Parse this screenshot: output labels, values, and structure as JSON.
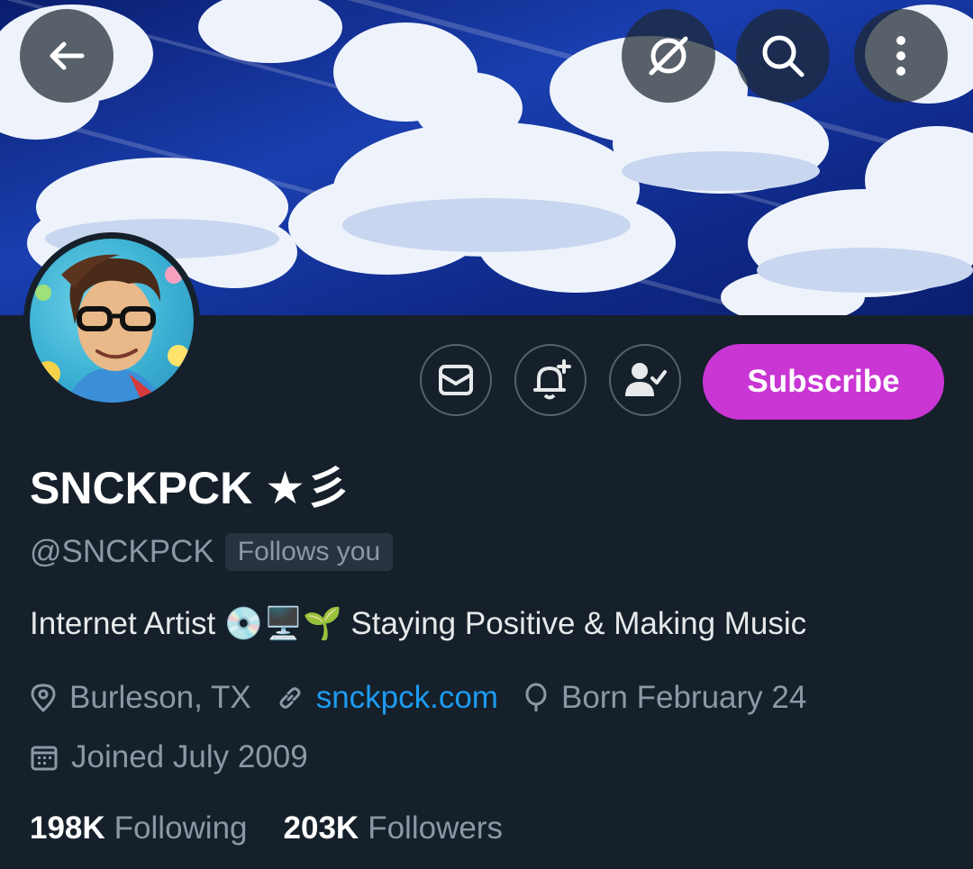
{
  "header": {
    "icons": [
      "back-arrow-icon",
      "grok-icon",
      "search-icon",
      "more-options-icon"
    ]
  },
  "profile": {
    "name": "SNCKPCK ★彡",
    "handle": "@SNCKPCK",
    "follows_you": "Follows you",
    "bio": "Internet Artist 💿🖥️🌱 Staying Positive & Making Music",
    "location": "Burleson, TX",
    "website": "snckpck.com",
    "birthday": "Born February 24",
    "joined": "Joined July 2009",
    "following_count": "198K",
    "following_label": "Following",
    "followers_count": "203K",
    "followers_label": "Followers"
  },
  "actions": {
    "subscribe_label": "Subscribe",
    "icons": [
      "message-icon",
      "notification-bell-add-icon",
      "following-user-check-icon"
    ]
  },
  "colors": {
    "background": "#15202b",
    "subscribe": "#c936d3",
    "link": "#1d9bf0",
    "secondary_text": "#8b98a5"
  }
}
